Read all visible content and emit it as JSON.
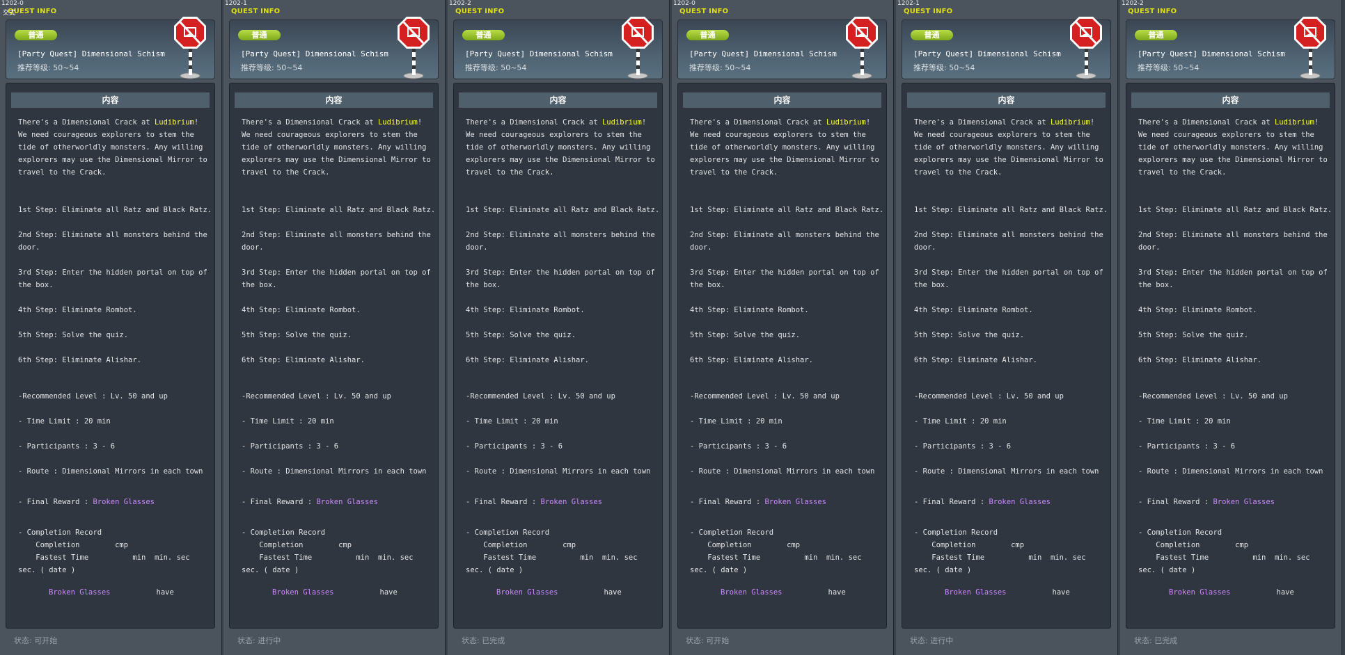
{
  "panels": [
    {
      "id": "1202-0",
      "status": "状态: 可开始"
    },
    {
      "id": "1202-1",
      "status": "状态: 进行中"
    },
    {
      "id": "1202-2",
      "status": "状态: 已完成"
    },
    {
      "id": "1202-0",
      "status": "状态: 可开始"
    },
    {
      "id": "1202-1",
      "status": "状态: 进行中"
    },
    {
      "id": "1202-2",
      "status": "状态: 已完成"
    }
  ],
  "overlay_text": "交式",
  "quest": {
    "title": "QUEST INFO",
    "badge": "普通",
    "name": "[Party Quest] Dimensional Schism",
    "level": "推荐等级: 50~54",
    "content_header": "内容",
    "desc_pre": "There's a Dimensional Crack at ",
    "desc_highlight": "Ludibrium",
    "desc_post": "! We need courageous explorers to stem the tide of otherworldly monsters. Any willing explorers may use the Dimensional Mirror to travel to the Crack.",
    "steps": [
      "1st Step: Eliminate all Ratz and Black Ratz.",
      "2nd Step: Eliminate all monsters behind the",
      "door.",
      "3rd Step: Enter the hidden portal on top of",
      "the box.",
      "4th Step: Eliminate Rombot.",
      "5th Step: Solve the quiz.",
      "6th Step: Eliminate Alishar."
    ],
    "info": [
      "-Recommended Level : Lv. 50 and up",
      "- Time Limit : 20 min",
      "- Participants : 3 - 6",
      "- Route : Dimensional Mirrors in each town"
    ],
    "final_reward_label": "- Final Reward :  ",
    "final_reward_item": "Broken Glasses",
    "record_title": "- Completion Record",
    "record_completion": "    Completion        cmp",
    "record_fastest": "    Fastest Time          min  min. sec",
    "record_date": "sec. ( date )",
    "footer_item": "Broken Glasses",
    "footer_have": "have"
  }
}
